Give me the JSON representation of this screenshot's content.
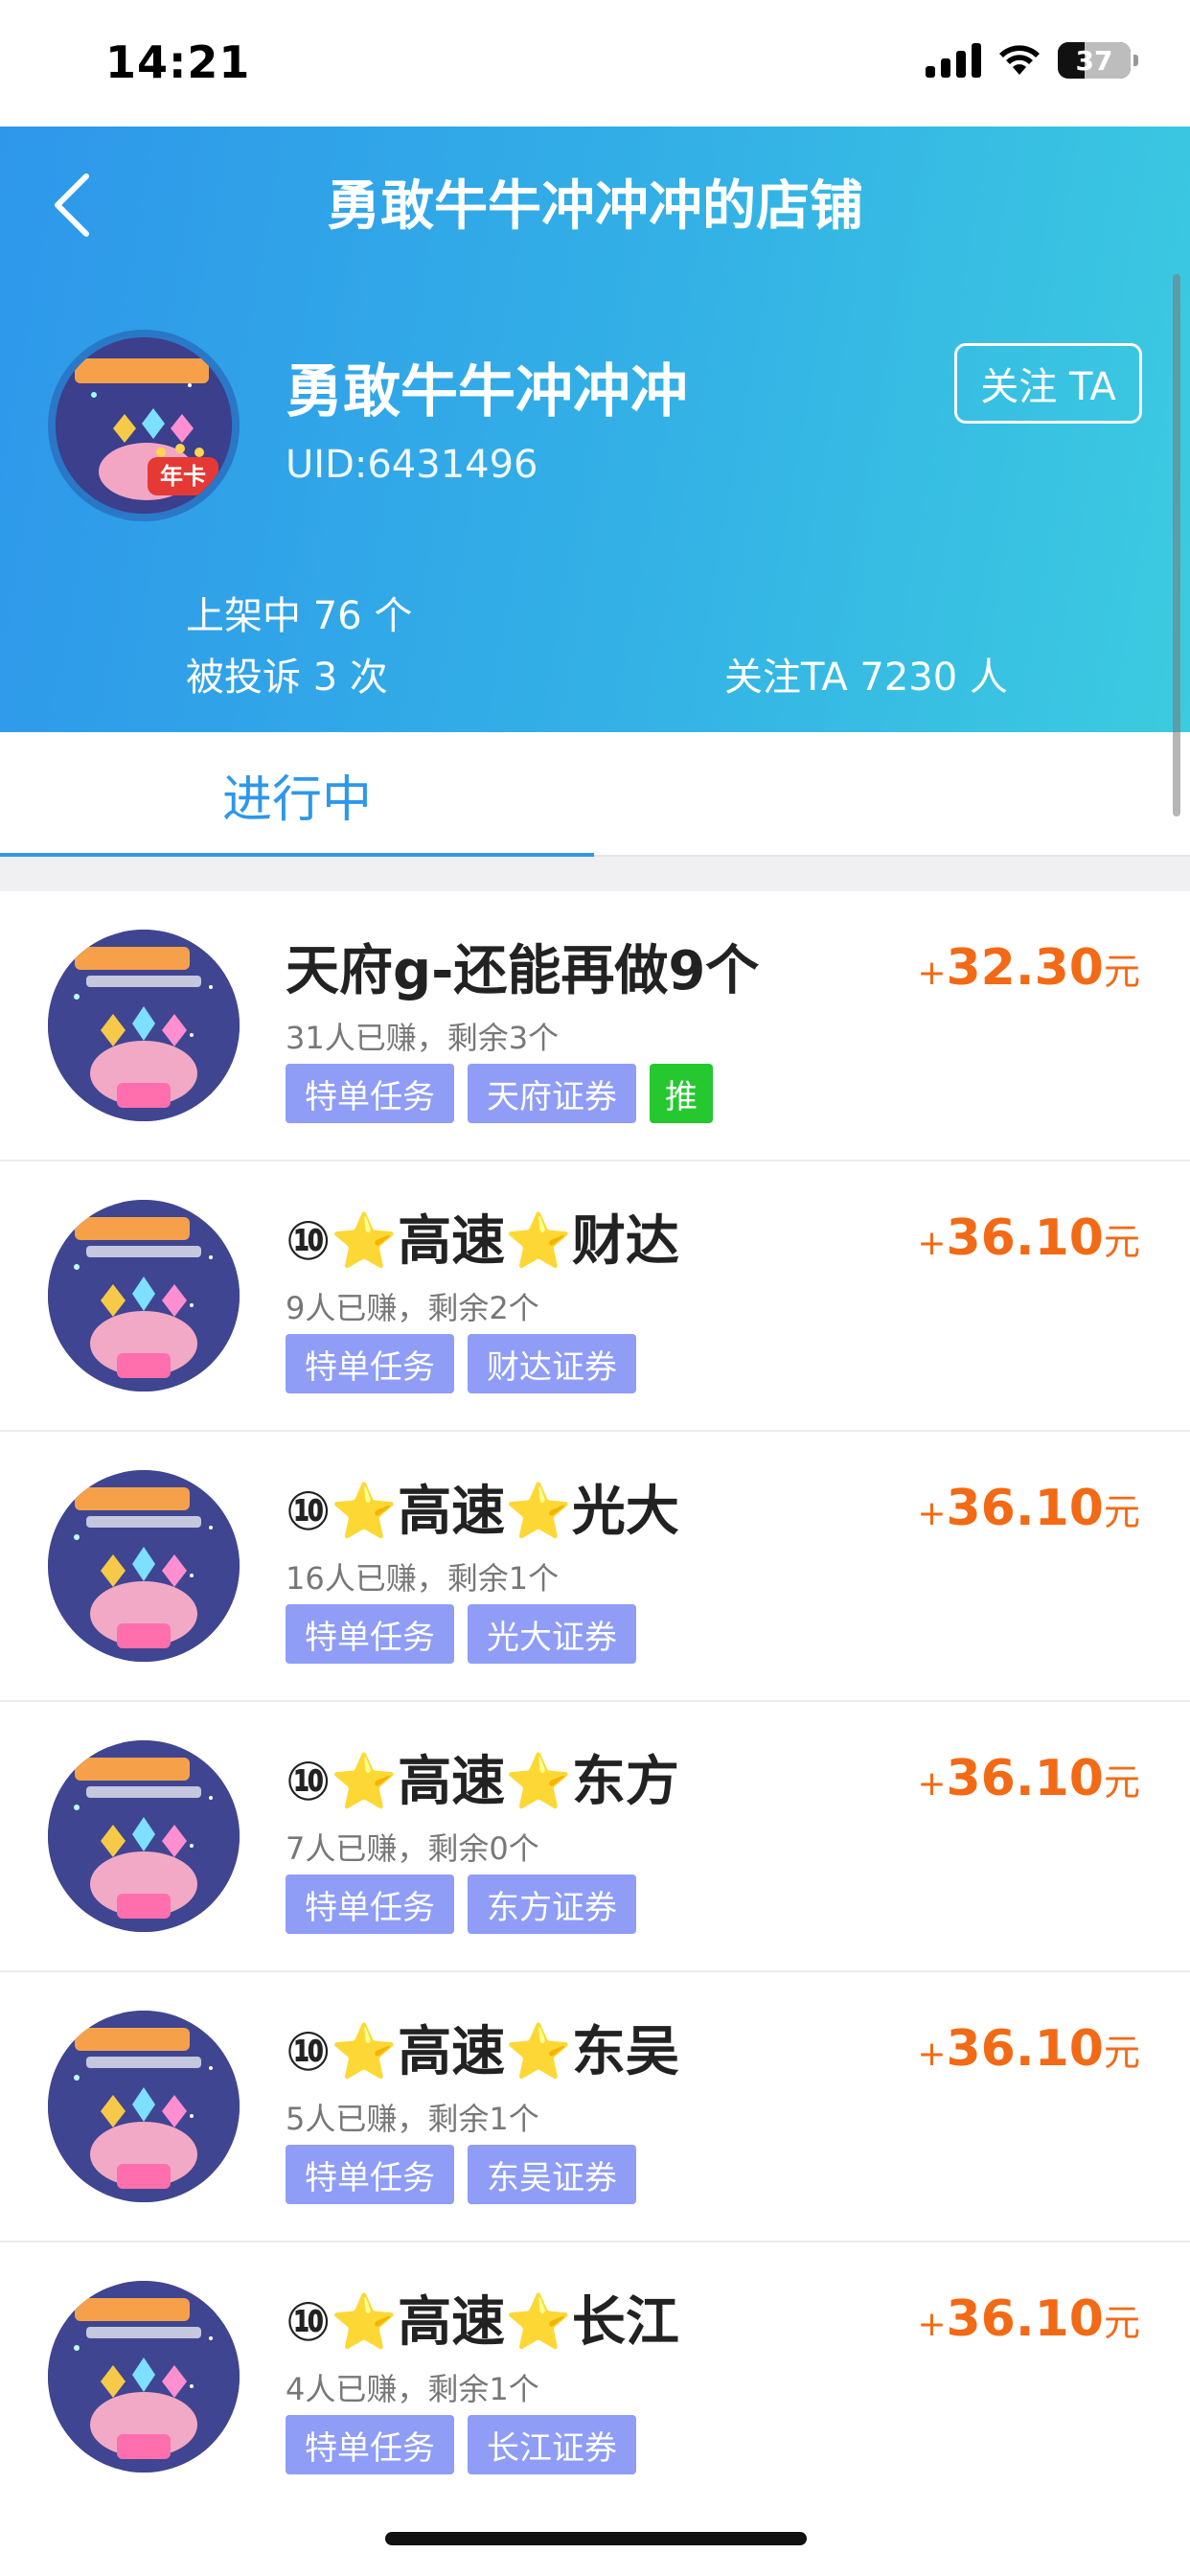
{
  "status_bar": {
    "time": "14:21",
    "battery": "37",
    "battery_level": 0.37
  },
  "header": {
    "title": "勇敢牛牛冲冲冲的店铺",
    "shop_name": "勇敢牛牛冲冲冲",
    "uid": "UID:6431496",
    "follow_label": "关注 TA",
    "avatar_badge": "年卡",
    "stats": {
      "on_shelf": "上架中 76 个",
      "complaints": "被投诉 3 次",
      "followers": "关注TA 7230 人"
    }
  },
  "tabs": [
    {
      "label": "进行中",
      "active": true
    }
  ],
  "colors": {
    "accent": "#2e97ea",
    "price": "#f26a15",
    "tag": "#8f9df6",
    "tag_recommend": "#25c92f"
  },
  "tasks": [
    {
      "title": "天府g-还能再做9个",
      "sub": "31人已赚，剩余3个",
      "tags": [
        "特单任务",
        "天府证券"
      ],
      "recommend": "推",
      "price_plus": "+",
      "price": "32.30",
      "unit": "元"
    },
    {
      "title": "⑩⭐高速⭐财达",
      "sub": "9人已赚，剩余2个",
      "tags": [
        "特单任务",
        "财达证券"
      ],
      "price_plus": "+",
      "price": "36.10",
      "unit": "元"
    },
    {
      "title": "⑩⭐高速⭐光大",
      "sub": "16人已赚，剩余1个",
      "tags": [
        "特单任务",
        "光大证券"
      ],
      "price_plus": "+",
      "price": "36.10",
      "unit": "元"
    },
    {
      "title": "⑩⭐高速⭐东方",
      "sub": "7人已赚，剩余0个",
      "tags": [
        "特单任务",
        "东方证券"
      ],
      "price_plus": "+",
      "price": "36.10",
      "unit": "元"
    },
    {
      "title": "⑩⭐高速⭐东吴",
      "sub": "5人已赚，剩余1个",
      "tags": [
        "特单任务",
        "东吴证券"
      ],
      "price_plus": "+",
      "price": "36.10",
      "unit": "元"
    },
    {
      "title": "⑩⭐高速⭐长江",
      "sub": "4人已赚，剩余1个",
      "tags": [
        "特单任务",
        "长江证券"
      ],
      "price_plus": "+",
      "price": "36.10",
      "unit": "元"
    }
  ]
}
